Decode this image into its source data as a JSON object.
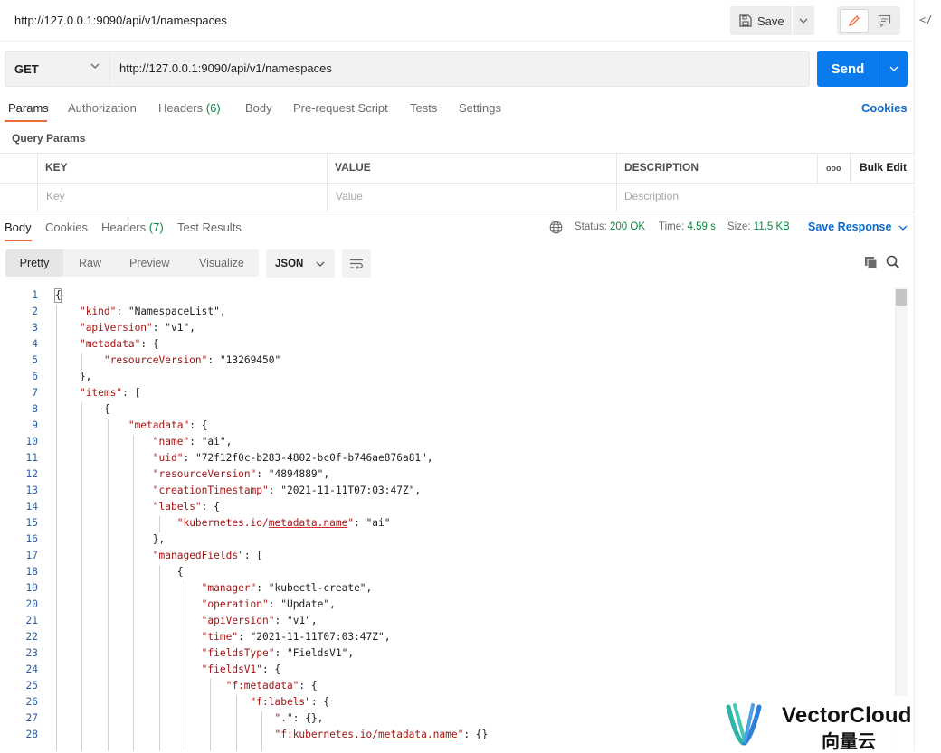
{
  "header": {
    "request_title": "http://127.0.0.1:9090/api/v1/namespaces",
    "save_label": "Save",
    "rail_icon_text": "</"
  },
  "request": {
    "method": "GET",
    "url": "http://127.0.0.1:9090/api/v1/namespaces",
    "send_label": "Send"
  },
  "request_tabs": [
    {
      "label": "Params"
    },
    {
      "label": "Authorization"
    },
    {
      "label": "Headers",
      "count": "(6)"
    },
    {
      "label": "Body"
    },
    {
      "label": "Pre-request Script"
    },
    {
      "label": "Tests"
    },
    {
      "label": "Settings"
    }
  ],
  "cookies_label": "Cookies",
  "query_params": {
    "title": "Query Params",
    "columns": [
      "KEY",
      "VALUE",
      "DESCRIPTION"
    ],
    "more_label": "ooo",
    "bulk_edit_label": "Bulk Edit",
    "placeholders": {
      "key": "Key",
      "value": "Value",
      "description": "Description"
    }
  },
  "response_tabs": [
    {
      "label": "Body"
    },
    {
      "label": "Cookies"
    },
    {
      "label": "Headers",
      "count": "(7)"
    },
    {
      "label": "Test Results"
    }
  ],
  "response_meta": {
    "status_label": "Status:",
    "status_value": "200 OK",
    "time_label": "Time:",
    "time_value": "4.59 s",
    "size_label": "Size:",
    "size_value": "11.5 KB",
    "save_response_label": "Save Response"
  },
  "view_modes": [
    "Pretty",
    "Raw",
    "Preview",
    "Visualize"
  ],
  "format_select": "JSON",
  "code_lines": [
    {
      "n": "1",
      "text": "{"
    },
    {
      "n": "2",
      "text": "    \"kind\": \"NamespaceList\","
    },
    {
      "n": "3",
      "text": "    \"apiVersion\": \"v1\","
    },
    {
      "n": "4",
      "text": "    \"metadata\": {"
    },
    {
      "n": "5",
      "text": "        \"resourceVersion\": \"13269450\""
    },
    {
      "n": "6",
      "text": "    },"
    },
    {
      "n": "7",
      "text": "    \"items\": ["
    },
    {
      "n": "8",
      "text": "        {"
    },
    {
      "n": "9",
      "text": "            \"metadata\": {"
    },
    {
      "n": "10",
      "text": "                \"name\": \"ai\","
    },
    {
      "n": "11",
      "text": "                \"uid\": \"72f12f0c-b283-4802-bc0f-b746ae876a81\","
    },
    {
      "n": "12",
      "text": "                \"resourceVersion\": \"4894889\","
    },
    {
      "n": "13",
      "text": "                \"creationTimestamp\": \"2021-11-11T07:03:47Z\","
    },
    {
      "n": "14",
      "text": "                \"labels\": {"
    },
    {
      "n": "15",
      "text": "                    \"kubernetes.io/metadata.name\": \"ai\""
    },
    {
      "n": "16",
      "text": "                },"
    },
    {
      "n": "17",
      "text": "                \"managedFields\": ["
    },
    {
      "n": "18",
      "text": "                    {"
    },
    {
      "n": "19",
      "text": "                        \"manager\": \"kubectl-create\","
    },
    {
      "n": "20",
      "text": "                        \"operation\": \"Update\","
    },
    {
      "n": "21",
      "text": "                        \"apiVersion\": \"v1\","
    },
    {
      "n": "22",
      "text": "                        \"time\": \"2021-11-11T07:03:47Z\","
    },
    {
      "n": "23",
      "text": "                        \"fieldsType\": \"FieldsV1\","
    },
    {
      "n": "24",
      "text": "                        \"fieldsV1\": {"
    },
    {
      "n": "25",
      "text": "                            \"f:metadata\": {"
    },
    {
      "n": "26",
      "text": "                                \"f:labels\": {"
    },
    {
      "n": "27",
      "text": "                                    \".\": {},"
    },
    {
      "n": "28",
      "text": "                                    \"f:kubernetes.io/metadata.name\": {}"
    }
  ],
  "watermark": {
    "brand": "VectorCloud",
    "sub": "向量云"
  },
  "colors": {
    "accent": "#f26b3a",
    "send": "#097bed",
    "link": "#0b6acc",
    "status_ok": "#0d8740",
    "json_key": "#a31515",
    "json_string": "#0451a5"
  }
}
